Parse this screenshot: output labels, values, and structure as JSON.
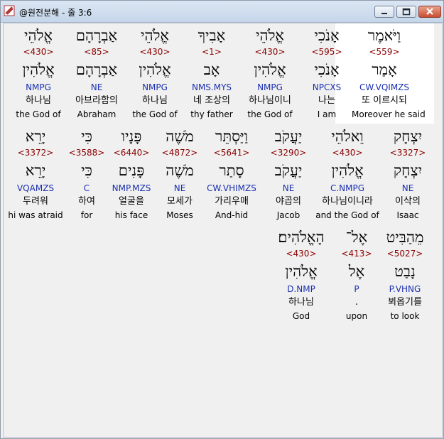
{
  "window": {
    "title": "@원전분해 - 줄 3:6"
  },
  "lines": [
    [
      {
        "word": "וַיֹּאמֶר",
        "strong": "<559>",
        "root": "אָמַר",
        "parse": "CW.VQIMZS",
        "korean": "또 이르시되",
        "english": "Moreover he said"
      },
      {
        "word": "אָנֹכִי",
        "strong": "<595>",
        "root": "אָנֹכִי",
        "parse": "NPCXS",
        "korean": "나는",
        "english": "I am"
      },
      {
        "word": "אֱלֹהֵי",
        "strong": "<430>",
        "root": "אֱלֹהִין",
        "parse": "NMPG",
        "korean": "하나님이니",
        "english": "the God of"
      },
      {
        "word": "אָבִיךָ",
        "strong": "<1>",
        "root": "אָב",
        "parse": "NMS.MYS",
        "korean": "네 조상의",
        "english": "thy father"
      },
      {
        "word": "אֱלֹהֵי",
        "strong": "<430>",
        "root": "אֱלֹהִין",
        "parse": "NMPG",
        "korean": "하나님",
        "english": "the God of"
      },
      {
        "word": "אַבְרָהָם",
        "strong": "<85>",
        "root": "אַבְרָהָם",
        "parse": "NE",
        "korean": "아브라함의",
        "english": "Abraham"
      },
      {
        "word": "אֱלֹהֵי",
        "strong": "<430>",
        "root": "אֱלֹהִין",
        "parse": "NMPG",
        "korean": "하나님",
        "english": "the God of"
      }
    ],
    [
      {
        "word": "יִצְחָק",
        "strong": "<3327>",
        "root": "יִצְחָק",
        "parse": "NE",
        "korean": "이삭의",
        "english": "Isaac"
      },
      {
        "word": "וֵאלֹהֵי",
        "strong": "<430>",
        "root": "אֱלֹהִין",
        "parse": "C.NMPG",
        "korean": "하나님이니라",
        "english": "and the God of"
      },
      {
        "word": "יַעֲקֹב",
        "strong": "<3290>",
        "root": "יַעֲקֹב",
        "parse": "NE",
        "korean": "야곱의",
        "english": "Jacob"
      },
      {
        "word": "וַיַּסְתֵּר",
        "strong": "<5641>",
        "root": "סָתַר",
        "parse": "CW.VHIMZS",
        "korean": "가리우매",
        "english": "And-hid"
      },
      {
        "word": "מֹשֶׁה",
        "strong": "<4872>",
        "root": "מֹשֶׁה",
        "parse": "NE",
        "korean": "모세가",
        "english": "Moses"
      },
      {
        "word": "פָּנָיו",
        "strong": "<6440>",
        "root": "פָּנִים",
        "parse": "NMP.MZS",
        "korean": "얼굴을",
        "english": "his face"
      },
      {
        "word": "כִּי",
        "strong": "<3588>",
        "root": "כִּי",
        "parse": "C",
        "korean": "하여",
        "english": "for"
      },
      {
        "word": "יָרֵא",
        "strong": "<3372>",
        "root": "יָרֵא",
        "parse": "VQAMZS",
        "korean": "두려워",
        "english": "hi was atraid"
      }
    ],
    [
      {
        "word": "מֵהַבִּיט",
        "strong": "<5027>",
        "root": "נָבַט",
        "parse": "P.VHNG",
        "korean": "뵈옵기를",
        "english": "to look"
      },
      {
        "word": "אֶל־",
        "strong": "<413>",
        "root": "אֶל",
        "parse": "P",
        "korean": ".",
        "english": "upon"
      },
      {
        "word": "הָאֱלֹהִים׃",
        "strong": "<430>",
        "root": "אֱלֹהִין",
        "parse": "D.NMP",
        "korean": "하나님",
        "english": "God"
      }
    ]
  ]
}
